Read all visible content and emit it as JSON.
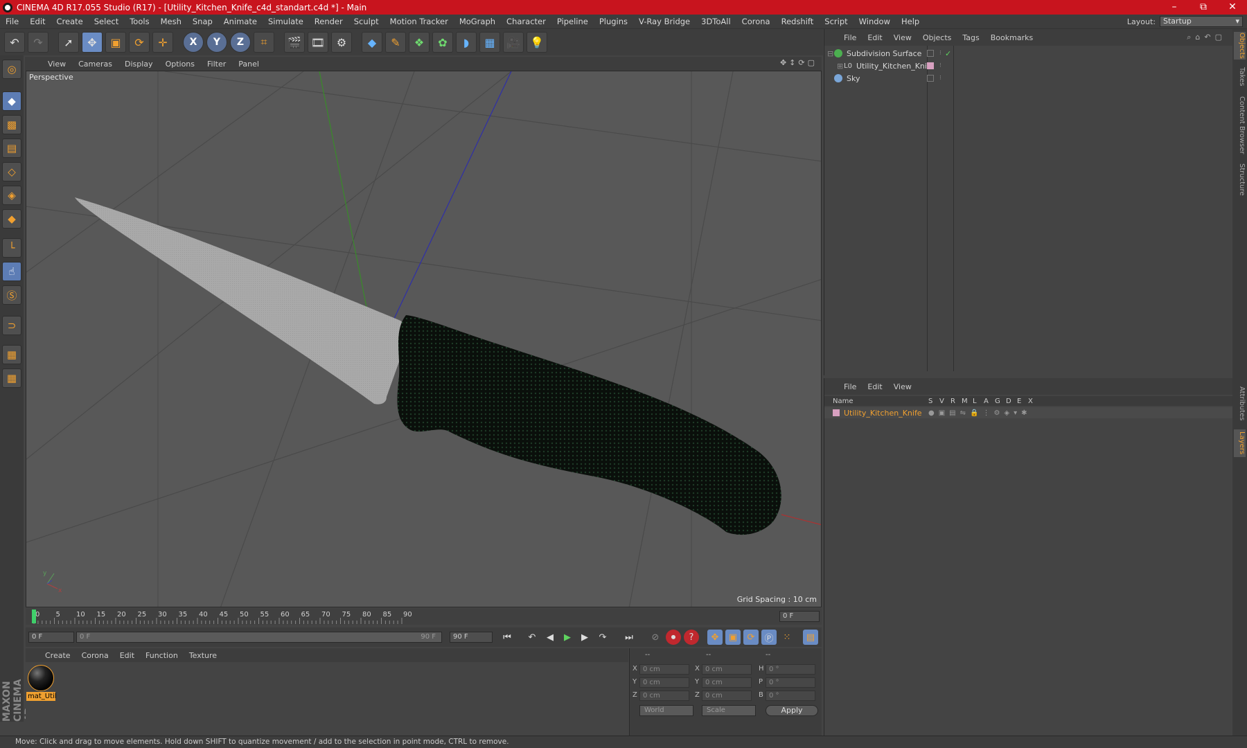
{
  "window": {
    "title": "CINEMA 4D R17.055 Studio (R17) - [Utility_Kitchen_Knife_c4d_standart.c4d *] - Main",
    "controls": [
      "–",
      "⧉",
      "✕"
    ]
  },
  "menubar": {
    "items": [
      "File",
      "Edit",
      "Create",
      "Select",
      "Tools",
      "Mesh",
      "Snap",
      "Animate",
      "Simulate",
      "Render",
      "Sculpt",
      "Motion Tracker",
      "MoGraph",
      "Character",
      "Pipeline",
      "Plugins",
      "V-Ray Bridge",
      "3DToAll",
      "Corona",
      "Redshift",
      "Script",
      "Window",
      "Help"
    ],
    "layout_label": "Layout:",
    "layout_value": "Startup"
  },
  "viewport": {
    "menu": [
      "View",
      "Cameras",
      "Display",
      "Options",
      "Filter",
      "Panel"
    ],
    "camera_label": "Perspective",
    "grid_spacing": "Grid Spacing : 10 cm"
  },
  "timeline": {
    "ticks": [
      "0",
      "5",
      "10",
      "15",
      "20",
      "25",
      "30",
      "35",
      "40",
      "45",
      "50",
      "55",
      "60",
      "65",
      "70",
      "75",
      "80",
      "85",
      "90"
    ],
    "current_frame": "0 F",
    "start_field": "0 F",
    "range_start": "0 F",
    "range_end": "90 F",
    "end_field": "90 F"
  },
  "material_manager": {
    "menu": [
      "Create",
      "Corona",
      "Edit",
      "Function",
      "Texture"
    ],
    "materials": [
      {
        "label": "mat_Util"
      }
    ]
  },
  "coordinates": {
    "headers": [
      "--",
      "--",
      "--"
    ],
    "rows": [
      {
        "a": "X",
        "av": "0 cm",
        "b": "X",
        "bv": "0 cm",
        "c": "H",
        "cv": "0 °"
      },
      {
        "a": "Y",
        "av": "0 cm",
        "b": "Y",
        "bv": "0 cm",
        "c": "P",
        "cv": "0 °"
      },
      {
        "a": "Z",
        "av": "0 cm",
        "b": "Z",
        "bv": "0 cm",
        "c": "B",
        "cv": "0 °"
      }
    ],
    "space": "World",
    "mode": "Scale",
    "apply": "Apply"
  },
  "object_manager": {
    "menu": [
      "File",
      "Edit",
      "View",
      "Objects",
      "Tags",
      "Bookmarks"
    ],
    "objects": [
      {
        "name": "Subdivision Surface",
        "icon_color": "#4caf50"
      },
      {
        "name": "Utility_Kitchen_Knife",
        "icon_color": "#999999"
      },
      {
        "name": "Sky",
        "icon_color": "#7aa6d8"
      }
    ]
  },
  "layer_manager": {
    "menu": [
      "File",
      "Edit",
      "View"
    ],
    "columns": [
      "Name",
      "S",
      "V",
      "R",
      "M",
      "L",
      "A",
      "G",
      "D",
      "E",
      "X"
    ],
    "layers": [
      {
        "name": "Utility_Kitchen_Knife",
        "color": "#d8a0c0"
      }
    ]
  },
  "right_tabs": [
    "Objects",
    "Takes",
    "Content Browser",
    "Structure",
    "Attributes",
    "Layers"
  ],
  "status": "Move: Click and drag to move elements. Hold down SHIFT to quantize movement / add to the selection in point mode, CTRL to remove.",
  "colors": {
    "titlebar": "#c8141e",
    "accent": "#f0a030",
    "selected_blue": "#6a8cc4"
  }
}
